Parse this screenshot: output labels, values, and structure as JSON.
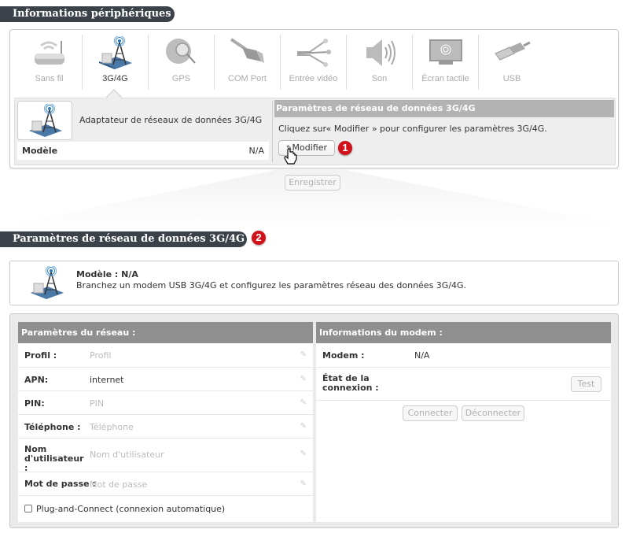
{
  "section1": {
    "title": "Informations périphériques",
    "tabs": [
      {
        "label": "Sans fil",
        "icon": "wireless-router-icon",
        "active": false
      },
      {
        "label": "3G/4G",
        "icon": "cell-tower-icon",
        "active": true
      },
      {
        "label": "GPS",
        "icon": "globe-magnifier-icon",
        "active": false
      },
      {
        "label": "COM Port",
        "icon": "serial-cable-icon",
        "active": false
      },
      {
        "label": "Entrée vidéo",
        "icon": "rca-cable-icon",
        "active": false
      },
      {
        "label": "Son",
        "icon": "speaker-icon",
        "active": false
      },
      {
        "label": "Écran tactile",
        "icon": "touchscreen-icon",
        "active": false
      },
      {
        "label": "USB",
        "icon": "usb-icon",
        "active": false
      }
    ],
    "device_name": "Adaptateur de réseaux de données 3G/4G",
    "model_label": "Modèle",
    "model_value": "N/A",
    "settings_header": "Paramètres de réseau de données 3G/4G",
    "settings_desc": "Cliquez sur« Modifier » pour configurer les paramètres 3G/4G.",
    "modify_label": "Modifier",
    "save_label": "Enregistrer",
    "badge": "1"
  },
  "section2": {
    "title": "Paramètres de réseau de données 3G/4G",
    "badge": "2",
    "model_title": "Modèle : N/A",
    "model_desc": "Branchez un modem USB 3G/4G et configurez les paramètres réseau des données 3G/4G.",
    "network": {
      "header": "Paramètres du réseau :",
      "fields": [
        {
          "label": "Profil :",
          "value": "",
          "placeholder": "Profil"
        },
        {
          "label": "APN:",
          "value": "internet",
          "placeholder": ""
        },
        {
          "label": "PIN:",
          "value": "",
          "placeholder": "PIN"
        },
        {
          "label": "Téléphone :",
          "value": "",
          "placeholder": "Téléphone"
        },
        {
          "label": "Nom d'utilisateur :",
          "value": "",
          "placeholder": "Nom d'utilisateur"
        },
        {
          "label": "Mot de passe :",
          "value": "",
          "placeholder": "Mot de passe"
        }
      ],
      "checkbox_label": "Plug-and-Connect (connexion automatique)",
      "checkbox_checked": false
    },
    "modem": {
      "header": "Informations du modem :",
      "modem_label": "Modem :",
      "modem_value": "N/A",
      "status_label": "État de la connexion :",
      "test_label": "Test",
      "connect_label": "Connecter",
      "disconnect_label": "Déconnecter"
    }
  }
}
